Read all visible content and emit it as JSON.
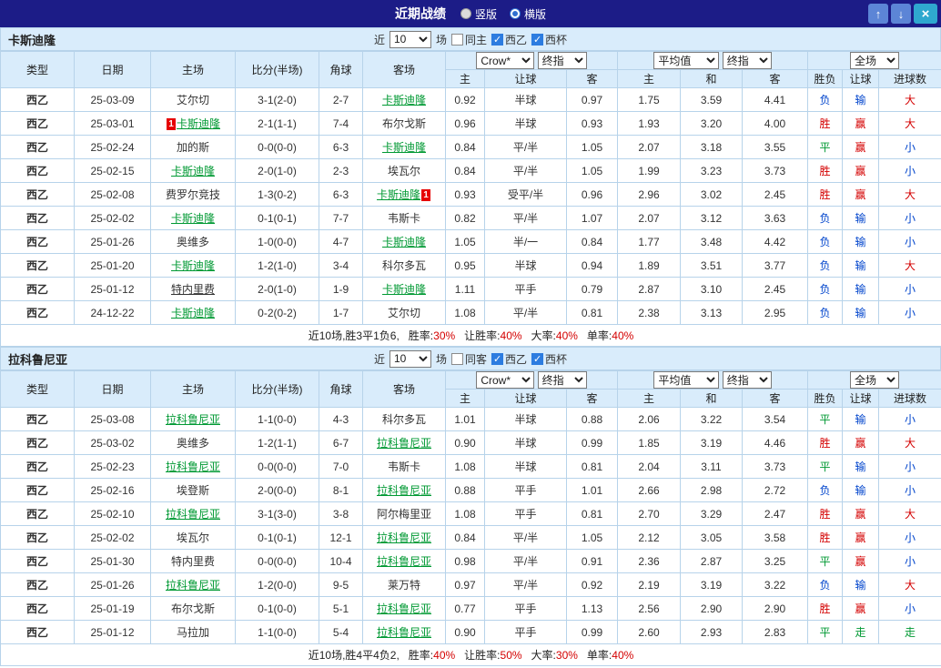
{
  "colors": {
    "win": "#d40000",
    "draw": "#009933",
    "lose": "#0044cc",
    "focus_team": "#009933",
    "score": "#d40000",
    "card_bg": "#e60000"
  },
  "titlebar": {
    "title": "近期战绩",
    "radios": [
      {
        "label": "竖版",
        "selected": false
      },
      {
        "label": "横版",
        "selected": true
      }
    ],
    "up_icon": "↑",
    "down_icon": "↓",
    "close_icon": "×"
  },
  "table_header": {
    "col_type": "类型",
    "col_date": "日期",
    "col_home": "主场",
    "col_score": "比分(半场)",
    "col_corner": "角球",
    "col_away": "客场",
    "group1_select1": "Crow*",
    "group1_select2": "终指",
    "group2_select1": "平均值",
    "group2_select2": "终指",
    "group3_select1": "全场",
    "sub_home": "主",
    "sub_handicap": "让球",
    "sub_away": "客",
    "sub_home2": "主",
    "sub_draw": "和",
    "sub_away2": "客",
    "sub_result": "胜负",
    "sub_handicap2": "让球",
    "sub_goals": "进球数"
  },
  "sections": [
    {
      "team_name": "卡斯迪隆",
      "controls": {
        "near": "近",
        "count": "10",
        "games": "场",
        "same": "同主",
        "same_checked": false,
        "league": "西乙",
        "league_checked": true,
        "cup": "西杯",
        "cup_checked": true
      },
      "rows": [
        {
          "league": "西乙",
          "date": "25-03-09",
          "home": "艾尔切",
          "away": "卡斯迪隆",
          "away_focus": true,
          "score": "3-1(2-0)",
          "corners": "2-7",
          "ah": "0.92",
          "hcp": "半球",
          "aa": "0.97",
          "eh": "1.75",
          "ed": "3.59",
          "ea": "4.41",
          "r": "负",
          "hr": "输",
          "gr": "大"
        },
        {
          "league": "西乙",
          "date": "25-03-01",
          "home": "卡斯迪隆",
          "home_focus": true,
          "home_card": "1",
          "away": "布尔戈斯",
          "score": "2-1(1-1)",
          "corners": "7-4",
          "ah": "0.96",
          "hcp": "半球",
          "aa": "0.93",
          "eh": "1.93",
          "ed": "3.20",
          "ea": "4.00",
          "r": "胜",
          "hr": "赢",
          "gr": "大"
        },
        {
          "league": "西乙",
          "date": "25-02-24",
          "home": "加的斯",
          "away": "卡斯迪隆",
          "away_focus": true,
          "score": "0-0(0-0)",
          "corners": "6-3",
          "ah": "0.84",
          "hcp": "平/半",
          "aa": "1.05",
          "eh": "2.07",
          "ed": "3.18",
          "ea": "3.55",
          "r": "平",
          "hr": "赢",
          "gr": "小"
        },
        {
          "league": "西乙",
          "date": "25-02-15",
          "home": "卡斯迪隆",
          "home_focus": true,
          "away": "埃瓦尔",
          "score": "2-0(1-0)",
          "corners": "2-3",
          "ah": "0.84",
          "hcp": "平/半",
          "aa": "1.05",
          "eh": "1.99",
          "ed": "3.23",
          "ea": "3.73",
          "r": "胜",
          "hr": "赢",
          "gr": "小"
        },
        {
          "league": "西乙",
          "date": "25-02-08",
          "home": "费罗尔竞技",
          "away": "卡斯迪隆",
          "away_focus": true,
          "away_card": "1",
          "score": "1-3(0-2)",
          "corners": "6-3",
          "ah": "0.93",
          "hcp": "受平/半",
          "aa": "0.96",
          "eh": "2.96",
          "ed": "3.02",
          "ea": "2.45",
          "r": "胜",
          "hr": "赢",
          "gr": "大"
        },
        {
          "league": "西乙",
          "date": "25-02-02",
          "home": "卡斯迪隆",
          "home_focus": true,
          "away": "韦斯卡",
          "score": "0-1(0-1)",
          "corners": "7-7",
          "ah": "0.82",
          "hcp": "平/半",
          "aa": "1.07",
          "eh": "2.07",
          "ed": "3.12",
          "ea": "3.63",
          "r": "负",
          "hr": "输",
          "gr": "小"
        },
        {
          "league": "西乙",
          "date": "25-01-26",
          "home": "奥维多",
          "away": "卡斯迪隆",
          "away_focus": true,
          "score": "1-0(0-0)",
          "corners": "4-7",
          "ah": "1.05",
          "hcp": "半/一",
          "aa": "0.84",
          "eh": "1.77",
          "ed": "3.48",
          "ea": "4.42",
          "r": "负",
          "hr": "输",
          "gr": "小"
        },
        {
          "league": "西乙",
          "date": "25-01-20",
          "home": "卡斯迪隆",
          "home_focus": true,
          "away": "科尔多瓦",
          "score": "1-2(1-0)",
          "corners": "3-4",
          "ah": "0.95",
          "hcp": "半球",
          "aa": "0.94",
          "eh": "1.89",
          "ed": "3.51",
          "ea": "3.77",
          "r": "负",
          "hr": "输",
          "gr": "大"
        },
        {
          "league": "西乙",
          "date": "25-01-12",
          "home": "特内里费",
          "home_link": true,
          "away": "卡斯迪隆",
          "away_focus": true,
          "score": "2-0(1-0)",
          "corners": "1-9",
          "ah": "1.11",
          "hcp": "平手",
          "aa": "0.79",
          "eh": "2.87",
          "ed": "3.10",
          "ea": "2.45",
          "r": "负",
          "hr": "输",
          "gr": "小"
        },
        {
          "league": "西乙",
          "date": "24-12-22",
          "home": "卡斯迪隆",
          "home_focus": true,
          "away": "艾尔切",
          "score": "0-2(0-2)",
          "corners": "1-7",
          "ah": "1.08",
          "hcp": "平/半",
          "aa": "0.81",
          "eh": "2.38",
          "ed": "3.13",
          "ea": "2.95",
          "r": "负",
          "hr": "输",
          "gr": "小"
        }
      ],
      "summary": {
        "prefix": "近10场,胜3平1负6,",
        "stats": [
          {
            "label": "胜率:",
            "value": "30%"
          },
          {
            "label": "让胜率:",
            "value": "40%"
          },
          {
            "label": "大率:",
            "value": "40%"
          },
          {
            "label": "单率:",
            "value": "40%"
          }
        ]
      }
    },
    {
      "team_name": "拉科鲁尼亚",
      "controls": {
        "near": "近",
        "count": "10",
        "games": "场",
        "same": "同客",
        "same_checked": false,
        "league": "西乙",
        "league_checked": true,
        "cup": "西杯",
        "cup_checked": true
      },
      "rows": [
        {
          "league": "西乙",
          "date": "25-03-08",
          "home": "拉科鲁尼亚",
          "home_focus": true,
          "away": "科尔多瓦",
          "score": "1-1(0-0)",
          "corners": "4-3",
          "ah": "1.01",
          "hcp": "半球",
          "aa": "0.88",
          "eh": "2.06",
          "ed": "3.22",
          "ea": "3.54",
          "r": "平",
          "hr": "输",
          "gr": "小"
        },
        {
          "league": "西乙",
          "date": "25-03-02",
          "home": "奥维多",
          "away": "拉科鲁尼亚",
          "away_focus": true,
          "score": "1-2(1-1)",
          "corners": "6-7",
          "ah": "0.90",
          "hcp": "半球",
          "aa": "0.99",
          "eh": "1.85",
          "ed": "3.19",
          "ea": "4.46",
          "r": "胜",
          "hr": "赢",
          "gr": "大"
        },
        {
          "league": "西乙",
          "date": "25-02-23",
          "home": "拉科鲁尼亚",
          "home_focus": true,
          "away": "韦斯卡",
          "score": "0-0(0-0)",
          "corners": "7-0",
          "ah": "1.08",
          "hcp": "半球",
          "aa": "0.81",
          "eh": "2.04",
          "ed": "3.11",
          "ea": "3.73",
          "r": "平",
          "hr": "输",
          "gr": "小"
        },
        {
          "league": "西乙",
          "date": "25-02-16",
          "home": "埃登斯",
          "away": "拉科鲁尼亚",
          "away_focus": true,
          "score": "2-0(0-0)",
          "corners": "8-1",
          "ah": "0.88",
          "hcp": "平手",
          "aa": "1.01",
          "eh": "2.66",
          "ed": "2.98",
          "ea": "2.72",
          "r": "负",
          "hr": "输",
          "gr": "小"
        },
        {
          "league": "西乙",
          "date": "25-02-10",
          "home": "拉科鲁尼亚",
          "home_focus": true,
          "away": "阿尔梅里亚",
          "score": "3-1(3-0)",
          "corners": "3-8",
          "ah": "1.08",
          "hcp": "平手",
          "aa": "0.81",
          "eh": "2.70",
          "ed": "3.29",
          "ea": "2.47",
          "r": "胜",
          "hr": "赢",
          "gr": "大"
        },
        {
          "league": "西乙",
          "date": "25-02-02",
          "home": "埃瓦尔",
          "away": "拉科鲁尼亚",
          "away_focus": true,
          "score": "0-1(0-1)",
          "corners": "12-1",
          "ah": "0.84",
          "hcp": "平/半",
          "aa": "1.05",
          "eh": "2.12",
          "ed": "3.05",
          "ea": "3.58",
          "r": "胜",
          "hr": "赢",
          "gr": "小"
        },
        {
          "league": "西乙",
          "date": "25-01-30",
          "home": "特内里费",
          "away": "拉科鲁尼亚",
          "away_focus": true,
          "score": "0-0(0-0)",
          "corners": "10-4",
          "ah": "0.98",
          "hcp": "平/半",
          "aa": "0.91",
          "eh": "2.36",
          "ed": "2.87",
          "ea": "3.25",
          "r": "平",
          "hr": "赢",
          "gr": "小"
        },
        {
          "league": "西乙",
          "date": "25-01-26",
          "home": "拉科鲁尼亚",
          "home_focus": true,
          "away": "莱万特",
          "score": "1-2(0-0)",
          "corners": "9-5",
          "ah": "0.97",
          "hcp": "平/半",
          "aa": "0.92",
          "eh": "2.19",
          "ed": "3.19",
          "ea": "3.22",
          "r": "负",
          "hr": "输",
          "gr": "大"
        },
        {
          "league": "西乙",
          "date": "25-01-19",
          "home": "布尔戈斯",
          "away": "拉科鲁尼亚",
          "away_focus": true,
          "score": "0-1(0-0)",
          "corners": "5-1",
          "ah": "0.77",
          "hcp": "平手",
          "aa": "1.13",
          "eh": "2.56",
          "ed": "2.90",
          "ea": "2.90",
          "r": "胜",
          "hr": "赢",
          "gr": "小"
        },
        {
          "league": "西乙",
          "date": "25-01-12",
          "home": "马拉加",
          "away": "拉科鲁尼亚",
          "away_focus": true,
          "score": "1-1(0-0)",
          "corners": "5-4",
          "ah": "0.90",
          "hcp": "平手",
          "aa": "0.99",
          "eh": "2.60",
          "ed": "2.93",
          "ea": "2.83",
          "r": "平",
          "hr": "走",
          "gr": "走"
        }
      ],
      "summary": {
        "prefix": "近10场,胜4平4负2,",
        "stats": [
          {
            "label": "胜率:",
            "value": "40%"
          },
          {
            "label": "让胜率:",
            "value": "50%"
          },
          {
            "label": "大率:",
            "value": "30%"
          },
          {
            "label": "单率:",
            "value": "40%"
          }
        ]
      }
    }
  ]
}
